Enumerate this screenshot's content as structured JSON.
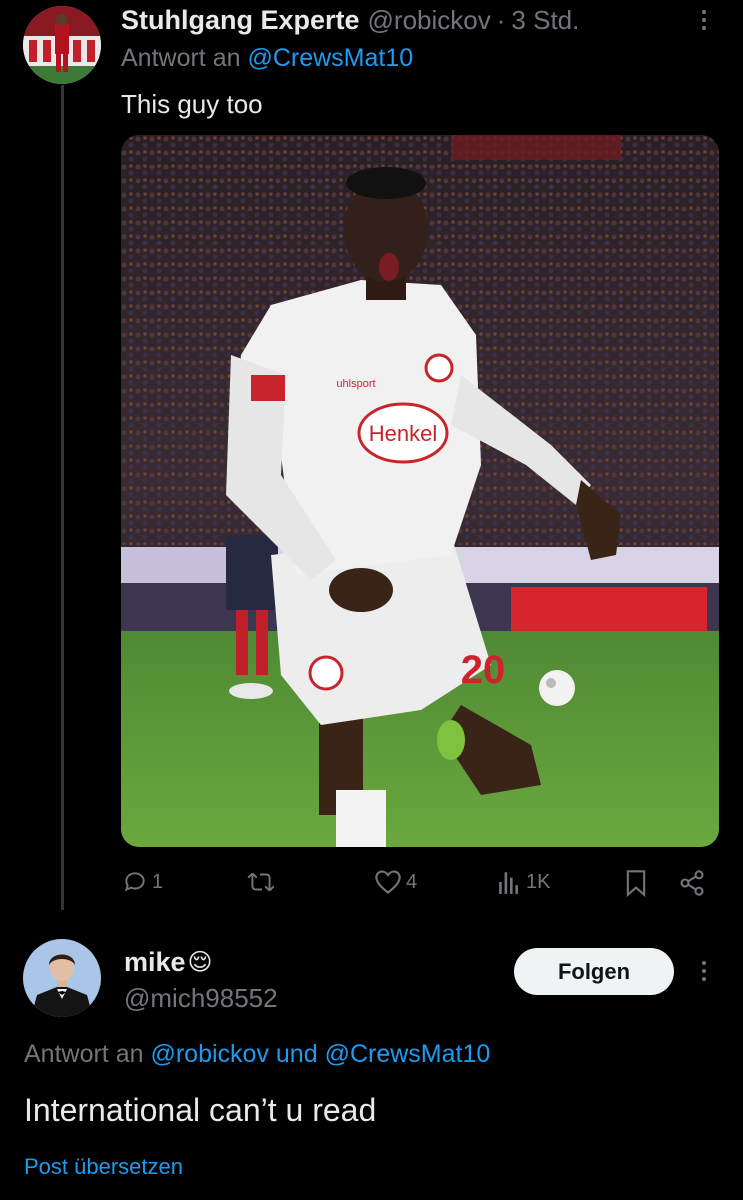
{
  "reply1": {
    "display_name": "Stuhlgang Experte",
    "handle": "@robickov",
    "separator": "·",
    "time": "3 Std.",
    "reply_prefix": "Antwort an",
    "reply_to": "@CrewsMat10",
    "text": "This guy too",
    "photo": {
      "jersey_sponsor": "Henkel",
      "kit_brand": "uhlsport",
      "shirt_number": "20"
    },
    "actions": {
      "replies": "1",
      "reposts": "",
      "likes": "4",
      "views": "1K"
    }
  },
  "reply2": {
    "display_name": "mike",
    "emoji": "😌",
    "handle": "@mich98552",
    "follow_label": "Folgen",
    "reply_prefix": "Antwort an",
    "reply_to_1": "@robickov",
    "reply_and": "und",
    "reply_to_2": "@CrewsMat10",
    "text": "International can’t u read",
    "translate_label": "Post übersetzen"
  },
  "colors": {
    "background": "#000000",
    "text": "#e7e9ea",
    "muted": "#71767b",
    "link": "#1d9bf0"
  }
}
